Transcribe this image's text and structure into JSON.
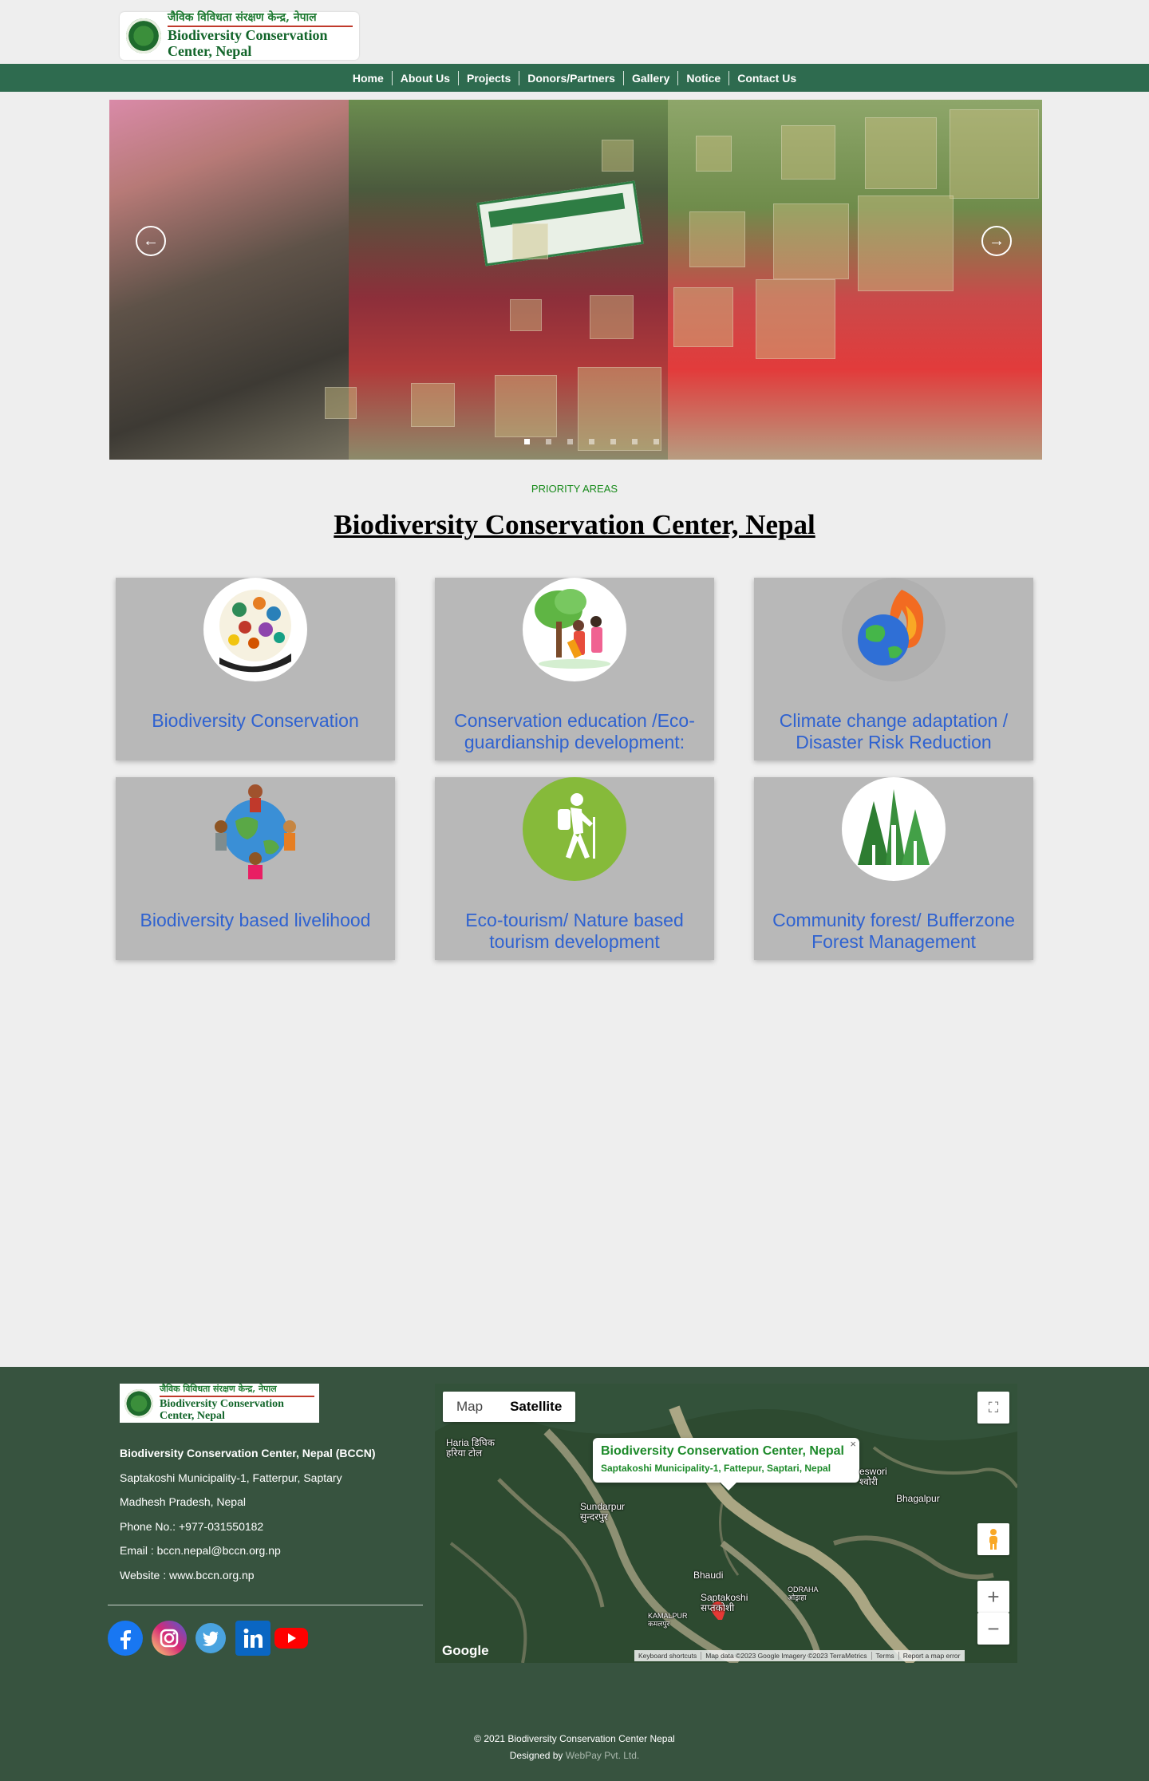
{
  "header": {
    "logo_nepali": "जैविक विविधता संरक्षण केन्द्र, नेपाल",
    "logo_english": "Biodiversity Conservation Center, Nepal"
  },
  "nav": {
    "items": [
      "Home",
      "About Us",
      "Projects",
      "Donors/Partners",
      "Gallery",
      "Notice",
      "Contact Us"
    ]
  },
  "slider": {
    "prev_icon": "arrow-left-circle-icon",
    "next_icon": "arrow-right-circle-icon",
    "dot_count": 7,
    "active_dot": 1
  },
  "priority": {
    "label": "PRIORITY AREAS",
    "title": "Biodiversity Conservation Center, Nepal",
    "cards": [
      {
        "title": "Biodiversity Conservation",
        "icon": "animals-in-hand-icon"
      },
      {
        "title": "Conservation education /Eco-guardianship development:",
        "icon": "tree-planting-icon"
      },
      {
        "title": "Climate change adaptation / Disaster Risk Reduction",
        "icon": "burning-earth-icon"
      },
      {
        "title": "Biodiversity based livelihood",
        "icon": "people-around-globe-icon"
      },
      {
        "title": "Eco-tourism/ Nature based tourism development",
        "icon": "hiker-icon"
      },
      {
        "title": "Community forest/ Bufferzone Forest Management",
        "icon": "forest-icon"
      }
    ]
  },
  "footer": {
    "org_name": "Biodiversity Conservation Center, Nepal (BCCN)",
    "address1": "Saptakoshi Municipality-1, Fatterpur, Saptary",
    "address2": "Madhesh Pradesh, Nepal",
    "phone": "Phone No.: +977-031550182",
    "email": "Email : bccn.nepal@bccn.org.np",
    "website": "Website : www.bccn.org.np",
    "social": [
      "facebook-icon",
      "instagram-icon",
      "twitter-icon",
      "linkedin-icon",
      "youtube-icon"
    ],
    "copyright": "© 2021 Biodiversity Conservation Center Nepal",
    "designed_by_prefix": "Designed by ",
    "designed_by_link": "WebPay Pvt. Ltd."
  },
  "map": {
    "tab_map": "Map",
    "tab_satellite": "Satellite",
    "popup_title": "Biodiversity Conservation Center, Nepal",
    "popup_subtitle": "Saptakoshi Municipality-1, Fattepur, Saptari, Nepal",
    "places": {
      "haria": "Haria",
      "haria_np": "हरिया",
      "dighik_np": "डिघिक",
      "tol_np": "टोल",
      "sundarpur": "Sundarpur",
      "sundarpur_np": "सुन्दरपुर",
      "bhaudi": "Bhaudi",
      "saptakoshi": "Saptakoshi",
      "saptakoshi_np": "सप्तकोशी",
      "kamalpur": "KAMALPUR",
      "kamalpur_np": "कमलपुर",
      "odraha": "ODRAHA",
      "odraha_np": "ओड्राहा",
      "bhagalpur": "Bhagalpur",
      "eswori": "eswori",
      "eswori_np": "श्वोरी"
    },
    "brand": "Google",
    "attribution": [
      "Keyboard shortcuts",
      "Map data ©2023 Google Imagery ©2023 TerraMetrics",
      "Terms",
      "Report a map error"
    ]
  },
  "colors": {
    "nav_bg": "#2e6b4f",
    "footer_bg": "#37533f",
    "card_bg": "#b8b8b8",
    "card_title": "#2f62d0",
    "accent_green": "#178a1a"
  }
}
